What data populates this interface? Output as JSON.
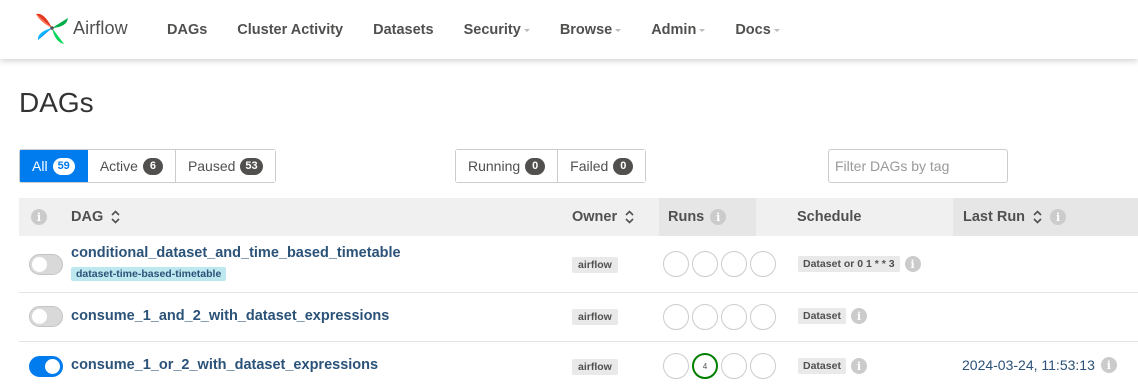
{
  "brand": {
    "name": "Airflow"
  },
  "nav": {
    "items": [
      {
        "label": "DAGs",
        "dropdown": false
      },
      {
        "label": "Cluster Activity",
        "dropdown": false
      },
      {
        "label": "Datasets",
        "dropdown": false
      },
      {
        "label": "Security",
        "dropdown": true
      },
      {
        "label": "Browse",
        "dropdown": true
      },
      {
        "label": "Admin",
        "dropdown": true
      },
      {
        "label": "Docs",
        "dropdown": true
      }
    ]
  },
  "page": {
    "title": "DAGs"
  },
  "status_filters": [
    {
      "label": "All",
      "count": "59",
      "active": true
    },
    {
      "label": "Active",
      "count": "6",
      "active": false
    },
    {
      "label": "Paused",
      "count": "53",
      "active": false
    }
  ],
  "run_filters": [
    {
      "label": "Running",
      "count": "0"
    },
    {
      "label": "Failed",
      "count": "0"
    }
  ],
  "tag_filter": {
    "placeholder": "Filter DAGs by tag",
    "value": ""
  },
  "table": {
    "headers": {
      "info": "i",
      "dag": "DAG",
      "owner": "Owner",
      "runs": "Runs",
      "schedule": "Schedule",
      "last_run": "Last Run"
    },
    "rows": [
      {
        "enabled": false,
        "dag_id": "conditional_dataset_and_time_based_timetable",
        "tag": "dataset-time-based-timetable",
        "owner": "airflow",
        "runs": [
          "",
          "",
          "",
          ""
        ],
        "schedule": "Dataset or 0 1 * * 3",
        "last_run": ""
      },
      {
        "enabled": false,
        "dag_id": "consume_1_and_2_with_dataset_expressions",
        "tag": "",
        "owner": "airflow",
        "runs": [
          "",
          "",
          "",
          ""
        ],
        "schedule": "Dataset",
        "last_run": ""
      },
      {
        "enabled": true,
        "dag_id": "consume_1_or_2_with_dataset_expressions",
        "tag": "",
        "owner": "airflow",
        "runs": [
          "",
          "4",
          "",
          ""
        ],
        "schedule": "Dataset",
        "last_run": "2024-03-24, 11:53:13"
      }
    ]
  },
  "colors": {
    "primary": "#017cee",
    "success": "#008000",
    "link": "#2b5278",
    "tag_bg": "#bde8ef"
  }
}
